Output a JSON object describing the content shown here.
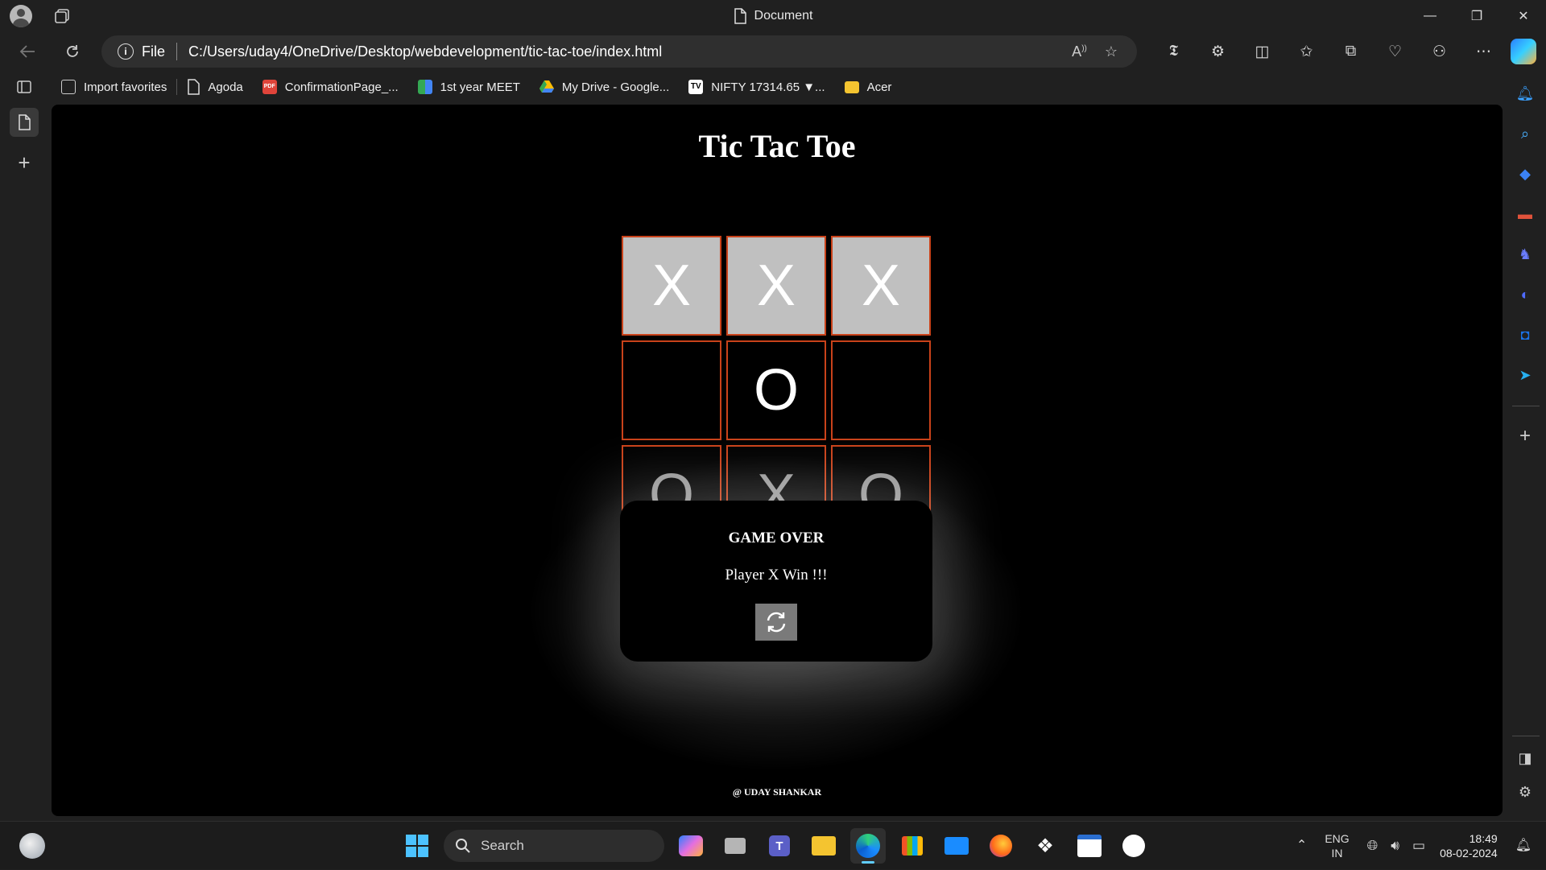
{
  "window": {
    "title": "Document",
    "controls": {
      "minimize": "—",
      "restore": "❐",
      "close": "✕"
    }
  },
  "address_bar": {
    "scheme_label": "File",
    "url": "C:/Users/uday4/OneDrive/Desktop/webdevelopment/tic-tac-toe/index.html"
  },
  "favorites": [
    {
      "label": "Import favorites",
      "icon": "import-icon",
      "color": "#cccccc"
    },
    {
      "label": "Agoda",
      "icon": "page-icon",
      "color": "#cccccc"
    },
    {
      "label": "ConfirmationPage_...",
      "icon": "pdf-icon",
      "color": "#e0443a"
    },
    {
      "label": "1st year MEET",
      "icon": "meet-icon",
      "color": "#34a853"
    },
    {
      "label": "My Drive - Google...",
      "icon": "drive-icon",
      "color": "#fbbc04"
    },
    {
      "label": "NIFTY 17314.65 ▼...",
      "icon": "tradingview-icon",
      "color": "#ffffff"
    },
    {
      "label": "Acer",
      "icon": "folder-icon",
      "color": "#f4c430"
    }
  ],
  "game": {
    "title": "Tic Tac Toe",
    "board": [
      "X",
      "X",
      "X",
      "",
      "O",
      "",
      "O",
      "X",
      "O"
    ],
    "winning_cells": [
      0,
      1,
      2
    ],
    "modal": {
      "title": "GAME OVER",
      "message": "Player X Win !!!",
      "restart_icon": "refresh-icon"
    },
    "footer": "@ UDAY SHANKAR"
  },
  "colors": {
    "cell_border": "#c9421a",
    "win_cell_bg": "#c0c0c0",
    "restart_bg": "#7a7a7a"
  },
  "taskbar": {
    "search_placeholder": "Search",
    "language": {
      "line1": "ENG",
      "line2": "IN"
    },
    "time": "18:49",
    "date": "08-02-2024"
  }
}
